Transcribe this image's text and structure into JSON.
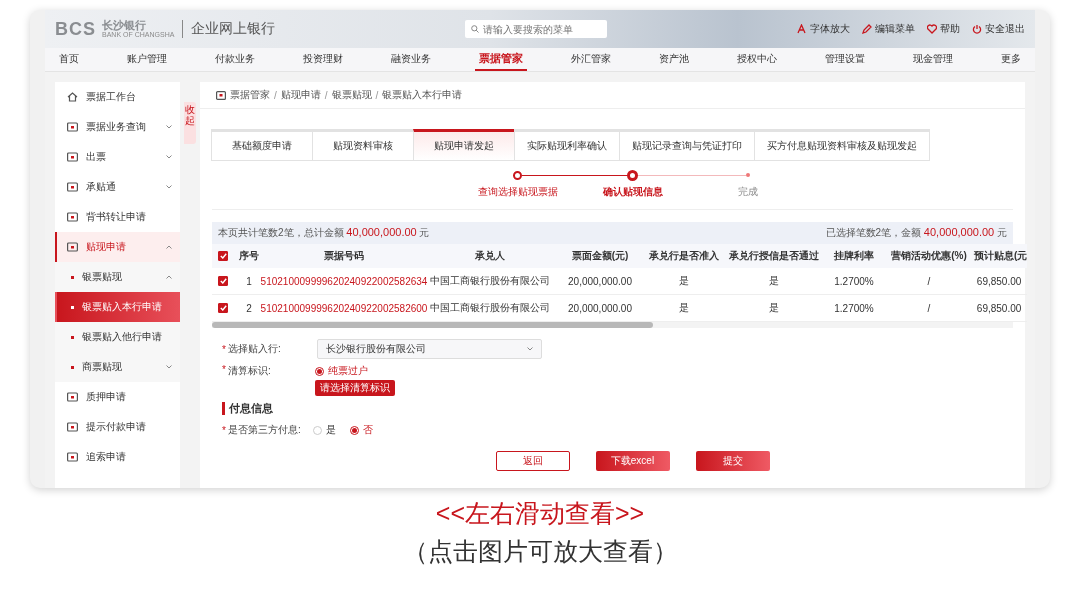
{
  "header": {
    "logo": "BCS",
    "bank_name": "长沙银行",
    "bank_name_en": "BANK OF CHANGSHA",
    "portal": "企业网上银行",
    "search": {
      "placeholder": "请输入要搜索的菜单"
    },
    "actions": [
      "字体放大",
      "编辑菜单",
      "帮助",
      "安全退出"
    ]
  },
  "nav": [
    {
      "label": "首页",
      "selected": false
    },
    {
      "label": "账户管理",
      "selected": false
    },
    {
      "label": "付款业务",
      "selected": false
    },
    {
      "label": "投资理财",
      "selected": false
    },
    {
      "label": "融资业务",
      "selected": false
    },
    {
      "label": "票据管家",
      "selected": true
    },
    {
      "label": "外汇管家",
      "selected": false
    },
    {
      "label": "资产池",
      "selected": false
    },
    {
      "label": "授权中心",
      "selected": false
    },
    {
      "label": "管理设置",
      "selected": false
    },
    {
      "label": "现金管理",
      "selected": false
    },
    {
      "label": "更多",
      "selected": false
    }
  ],
  "sidebar": {
    "collapse_label": "收起",
    "items": [
      {
        "label": "票据工作台",
        "selected": false
      },
      {
        "label": "票据业务查询",
        "selected": false,
        "expanded": false
      },
      {
        "label": "出票",
        "selected": false,
        "expanded": false
      },
      {
        "label": "承贴通",
        "selected": false,
        "expanded": false
      },
      {
        "label": "背书转让申请",
        "selected": false
      },
      {
        "label": "贴现申请",
        "selected": false,
        "expanded": true,
        "children": [
          {
            "label": "银票贴现",
            "selected": false,
            "expanded": true
          },
          {
            "label": "银票贴入本行申请",
            "selected": true
          },
          {
            "label": "银票贴入他行申请",
            "selected": false
          },
          {
            "label": "商票贴现",
            "selected": false,
            "expanded": false
          }
        ]
      },
      {
        "label": "质押申请",
        "selected": false
      },
      {
        "label": "提示付款申请",
        "selected": false
      },
      {
        "label": "追索申请",
        "selected": false
      }
    ]
  },
  "breadcrumb": [
    {
      "label": "票据管家"
    },
    {
      "separator": "/",
      "label": "贴现申请"
    },
    {
      "separator": "/",
      "label": "银票贴现"
    },
    {
      "separator": "/",
      "label": "银票贴入本行申请"
    }
  ],
  "tabs": [
    {
      "label": "基础额度申请",
      "selected": false
    },
    {
      "label": "贴现资料审核",
      "selected": false
    },
    {
      "label": "贴现申请发起",
      "selected": true
    },
    {
      "label": "实际贴现利率确认",
      "selected": false
    },
    {
      "label": "贴现记录查询与凭证打印",
      "selected": false
    },
    {
      "label": "买方付息贴现资料审核及贴现发起",
      "selected": false
    }
  ],
  "steps": [
    {
      "label": "查询选择贴现票据",
      "completed": true,
      "selected": false
    },
    {
      "label": "确认贴现信息",
      "completed": false,
      "selected": true
    },
    {
      "label": "完成",
      "completed": false,
      "selected": false
    }
  ],
  "summary": {
    "left": {
      "text": "本页共计笔数2笔，总计金额",
      "amount": "40,000,000.00",
      "unit": "元"
    },
    "right": {
      "text": "已选择笔数2笔，金额",
      "amount": "40,000,000.00",
      "unit": "元"
    }
  },
  "table": {
    "all_checked": true,
    "columns": [
      "序号",
      "票据号码",
      "承兑人",
      "票面金额(元)",
      "承兑行是否准入",
      "承兑行授信是否通过",
      "挂牌利率",
      "营销活动优惠(%)",
      "预计贴息(元"
    ],
    "rows": [
      {
        "checked": true,
        "cells": [
          "1",
          "510210009999620240922002582634",
          "中国工商银行股份有限公司",
          "20,000,000.00",
          "是",
          "是",
          "1.2700%",
          "/",
          "69,850.00"
        ]
      },
      {
        "checked": true,
        "cells": [
          "2",
          "510210009999620240922002582600",
          "中国工商银行股份有限公司",
          "20,000,000.00",
          "是",
          "是",
          "1.2700%",
          "/",
          "69,850.00"
        ]
      }
    ]
  },
  "form": {
    "bank": {
      "required_mark": "*",
      "label": "选择贴入行:",
      "value": "长沙银行股份有限公司"
    },
    "clearing": {
      "required_mark": "*",
      "label": "清算标识:",
      "options": [
        {
          "label": "纯票过户",
          "selected": true
        }
      ],
      "tooltip": "请选择清算标识"
    },
    "section_title": "付息信息",
    "third_party": {
      "required_mark": "*",
      "label": "是否第三方付息:",
      "options": [
        {
          "label": "是",
          "selected": false
        },
        {
          "label": "否",
          "selected": true
        }
      ]
    }
  },
  "buttons": [
    {
      "label": "返回",
      "kind": "secondary"
    },
    {
      "label": "下载excel",
      "kind": "primary"
    },
    {
      "label": "提交",
      "kind": "primary"
    }
  ],
  "caption": [
    "<<左右滑动查看>>",
    "（点击图片可放大查看）"
  ]
}
